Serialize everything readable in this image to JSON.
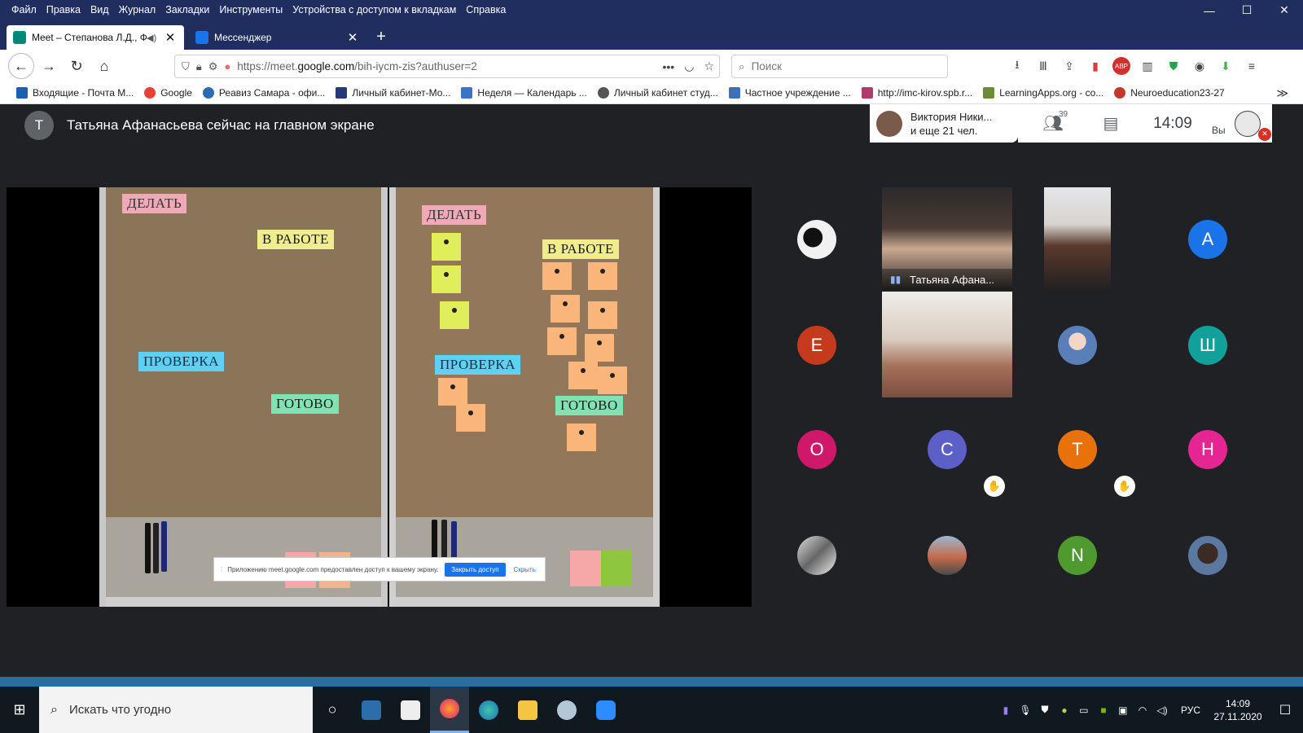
{
  "menubar": {
    "items": [
      "Файл",
      "Правка",
      "Вид",
      "Журнал",
      "Закладки",
      "Инструменты",
      "Устройства с доступом к вкладкам",
      "Справка"
    ],
    "minimize": "—",
    "maximize": "☐",
    "close": "✕"
  },
  "tabs": [
    {
      "label": "Meet – Степанова Л.Д., Фаі",
      "icon_color": "#00897b",
      "close": "✕",
      "sound": "◀)"
    },
    {
      "label": "Мессенджер",
      "icon_color": "#1a73e8",
      "close": "✕"
    }
  ],
  "newtab": "+",
  "nav": {
    "back": "←",
    "forward": "→",
    "reload": "↻",
    "home": "⌂",
    "url_prefix": "https://meet.",
    "url_host": "google.com",
    "url_path": "/bih-iycm-zis?authuser=2",
    "url_more": "•••",
    "search_placeholder": "Поиск"
  },
  "bookmarks": [
    {
      "label": "Входящие - Почта М...",
      "color": "#1a5fb4"
    },
    {
      "label": "Google",
      "color": "#e94235"
    },
    {
      "label": "Реавиз Самара - офи...",
      "color": "#2b6cb0"
    },
    {
      "label": "Личный кабинет-Мо...",
      "color": "#223a7a"
    },
    {
      "label": "Неделя — Календарь ...",
      "color": "#3b73c7"
    },
    {
      "label": "Личный кабинет студ...",
      "color": "#555555"
    },
    {
      "label": "Частное учреждение ...",
      "color": "#3f6fb5"
    },
    {
      "label": "http://imc-kirov.spb.r...",
      "color": "#b03a6a"
    },
    {
      "label": "LearningApps.org - co...",
      "color": "#6c8a3a"
    },
    {
      "label": "Neuroeducation23-27",
      "color": "#c0392b"
    }
  ],
  "bookmarks_more": "≫",
  "meet": {
    "presenter_initial": "Т",
    "presenter_text": "Татьяна Афанасьева сейчас на главном экране",
    "participants_line1": "Виктория Ники...",
    "participants_line2": "и еще 21 чел.",
    "people_icon": "people-icon",
    "people_count": "39",
    "chat_icon": "chat-icon",
    "time": "14:09",
    "you_label": "Вы",
    "self_badge": "✕"
  },
  "board": {
    "left": {
      "todo": "ДЕЛАТЬ",
      "in_progress": "В РАБОТЕ",
      "review": "ПРОВЕРКА",
      "done": "ГОТОВО"
    },
    "right": {
      "todo": "ДЕЛАТЬ",
      "in_progress": "В РАБОТЕ",
      "review": "ПРОВЕРКА",
      "done": "ГОТОВО"
    }
  },
  "share_banner": {
    "text": "Приложению meet.google.com предоставлен доступ к вашему экрану.",
    "stop": "Закрыть доступ",
    "hide": "Скрыть"
  },
  "tiles": {
    "featured_name": "Татьяна Афана...",
    "avatars": [
      {
        "letter": "A",
        "color": "#1a73e8"
      },
      {
        "letter": "E",
        "color": "#c5391d"
      },
      {
        "letter": "Ш",
        "color": "#12a19a"
      },
      {
        "letter": "O",
        "color": "#d0186b"
      },
      {
        "letter": "C",
        "color": "#5b5fc7"
      },
      {
        "letter": "T",
        "color": "#e8710a"
      },
      {
        "letter": "H",
        "color": "#e52592"
      },
      {
        "letter": "N",
        "color": "#4e9a2e"
      }
    ],
    "hand_icon": "✋"
  },
  "taskbar": {
    "start_icon": "⊞",
    "search_placeholder": "Искать что угодно",
    "task_view": "○",
    "lang": "РУС",
    "time": "14:09",
    "date": "27.11.2020",
    "notifications": "☐"
  }
}
